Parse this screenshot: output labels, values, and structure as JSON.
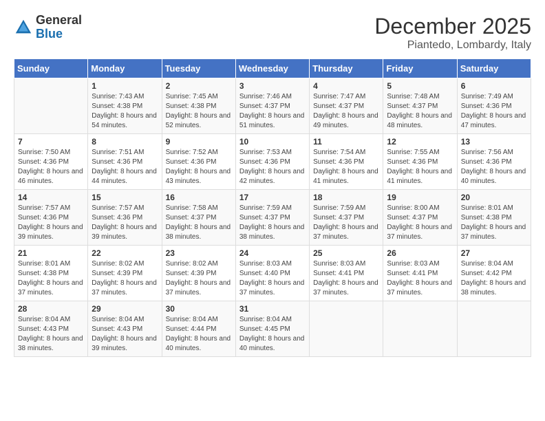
{
  "logo": {
    "general": "General",
    "blue": "Blue"
  },
  "title": {
    "month": "December 2025",
    "location": "Piantedo, Lombardy, Italy"
  },
  "days_of_week": [
    "Sunday",
    "Monday",
    "Tuesday",
    "Wednesday",
    "Thursday",
    "Friday",
    "Saturday"
  ],
  "weeks": [
    [
      {
        "day": "",
        "sunrise": "",
        "sunset": "",
        "daylight": ""
      },
      {
        "day": "1",
        "sunrise": "Sunrise: 7:43 AM",
        "sunset": "Sunset: 4:38 PM",
        "daylight": "Daylight: 8 hours and 54 minutes."
      },
      {
        "day": "2",
        "sunrise": "Sunrise: 7:45 AM",
        "sunset": "Sunset: 4:38 PM",
        "daylight": "Daylight: 8 hours and 52 minutes."
      },
      {
        "day": "3",
        "sunrise": "Sunrise: 7:46 AM",
        "sunset": "Sunset: 4:37 PM",
        "daylight": "Daylight: 8 hours and 51 minutes."
      },
      {
        "day": "4",
        "sunrise": "Sunrise: 7:47 AM",
        "sunset": "Sunset: 4:37 PM",
        "daylight": "Daylight: 8 hours and 49 minutes."
      },
      {
        "day": "5",
        "sunrise": "Sunrise: 7:48 AM",
        "sunset": "Sunset: 4:37 PM",
        "daylight": "Daylight: 8 hours and 48 minutes."
      },
      {
        "day": "6",
        "sunrise": "Sunrise: 7:49 AM",
        "sunset": "Sunset: 4:36 PM",
        "daylight": "Daylight: 8 hours and 47 minutes."
      }
    ],
    [
      {
        "day": "7",
        "sunrise": "Sunrise: 7:50 AM",
        "sunset": "Sunset: 4:36 PM",
        "daylight": "Daylight: 8 hours and 46 minutes."
      },
      {
        "day": "8",
        "sunrise": "Sunrise: 7:51 AM",
        "sunset": "Sunset: 4:36 PM",
        "daylight": "Daylight: 8 hours and 44 minutes."
      },
      {
        "day": "9",
        "sunrise": "Sunrise: 7:52 AM",
        "sunset": "Sunset: 4:36 PM",
        "daylight": "Daylight: 8 hours and 43 minutes."
      },
      {
        "day": "10",
        "sunrise": "Sunrise: 7:53 AM",
        "sunset": "Sunset: 4:36 PM",
        "daylight": "Daylight: 8 hours and 42 minutes."
      },
      {
        "day": "11",
        "sunrise": "Sunrise: 7:54 AM",
        "sunset": "Sunset: 4:36 PM",
        "daylight": "Daylight: 8 hours and 41 minutes."
      },
      {
        "day": "12",
        "sunrise": "Sunrise: 7:55 AM",
        "sunset": "Sunset: 4:36 PM",
        "daylight": "Daylight: 8 hours and 41 minutes."
      },
      {
        "day": "13",
        "sunrise": "Sunrise: 7:56 AM",
        "sunset": "Sunset: 4:36 PM",
        "daylight": "Daylight: 8 hours and 40 minutes."
      }
    ],
    [
      {
        "day": "14",
        "sunrise": "Sunrise: 7:57 AM",
        "sunset": "Sunset: 4:36 PM",
        "daylight": "Daylight: 8 hours and 39 minutes."
      },
      {
        "day": "15",
        "sunrise": "Sunrise: 7:57 AM",
        "sunset": "Sunset: 4:36 PM",
        "daylight": "Daylight: 8 hours and 39 minutes."
      },
      {
        "day": "16",
        "sunrise": "Sunrise: 7:58 AM",
        "sunset": "Sunset: 4:37 PM",
        "daylight": "Daylight: 8 hours and 38 minutes."
      },
      {
        "day": "17",
        "sunrise": "Sunrise: 7:59 AM",
        "sunset": "Sunset: 4:37 PM",
        "daylight": "Daylight: 8 hours and 38 minutes."
      },
      {
        "day": "18",
        "sunrise": "Sunrise: 7:59 AM",
        "sunset": "Sunset: 4:37 PM",
        "daylight": "Daylight: 8 hours and 37 minutes."
      },
      {
        "day": "19",
        "sunrise": "Sunrise: 8:00 AM",
        "sunset": "Sunset: 4:37 PM",
        "daylight": "Daylight: 8 hours and 37 minutes."
      },
      {
        "day": "20",
        "sunrise": "Sunrise: 8:01 AM",
        "sunset": "Sunset: 4:38 PM",
        "daylight": "Daylight: 8 hours and 37 minutes."
      }
    ],
    [
      {
        "day": "21",
        "sunrise": "Sunrise: 8:01 AM",
        "sunset": "Sunset: 4:38 PM",
        "daylight": "Daylight: 8 hours and 37 minutes."
      },
      {
        "day": "22",
        "sunrise": "Sunrise: 8:02 AM",
        "sunset": "Sunset: 4:39 PM",
        "daylight": "Daylight: 8 hours and 37 minutes."
      },
      {
        "day": "23",
        "sunrise": "Sunrise: 8:02 AM",
        "sunset": "Sunset: 4:39 PM",
        "daylight": "Daylight: 8 hours and 37 minutes."
      },
      {
        "day": "24",
        "sunrise": "Sunrise: 8:03 AM",
        "sunset": "Sunset: 4:40 PM",
        "daylight": "Daylight: 8 hours and 37 minutes."
      },
      {
        "day": "25",
        "sunrise": "Sunrise: 8:03 AM",
        "sunset": "Sunset: 4:41 PM",
        "daylight": "Daylight: 8 hours and 37 minutes."
      },
      {
        "day": "26",
        "sunrise": "Sunrise: 8:03 AM",
        "sunset": "Sunset: 4:41 PM",
        "daylight": "Daylight: 8 hours and 37 minutes."
      },
      {
        "day": "27",
        "sunrise": "Sunrise: 8:04 AM",
        "sunset": "Sunset: 4:42 PM",
        "daylight": "Daylight: 8 hours and 38 minutes."
      }
    ],
    [
      {
        "day": "28",
        "sunrise": "Sunrise: 8:04 AM",
        "sunset": "Sunset: 4:43 PM",
        "daylight": "Daylight: 8 hours and 38 minutes."
      },
      {
        "day": "29",
        "sunrise": "Sunrise: 8:04 AM",
        "sunset": "Sunset: 4:43 PM",
        "daylight": "Daylight: 8 hours and 39 minutes."
      },
      {
        "day": "30",
        "sunrise": "Sunrise: 8:04 AM",
        "sunset": "Sunset: 4:44 PM",
        "daylight": "Daylight: 8 hours and 40 minutes."
      },
      {
        "day": "31",
        "sunrise": "Sunrise: 8:04 AM",
        "sunset": "Sunset: 4:45 PM",
        "daylight": "Daylight: 8 hours and 40 minutes."
      },
      {
        "day": "",
        "sunrise": "",
        "sunset": "",
        "daylight": ""
      },
      {
        "day": "",
        "sunrise": "",
        "sunset": "",
        "daylight": ""
      },
      {
        "day": "",
        "sunrise": "",
        "sunset": "",
        "daylight": ""
      }
    ]
  ]
}
